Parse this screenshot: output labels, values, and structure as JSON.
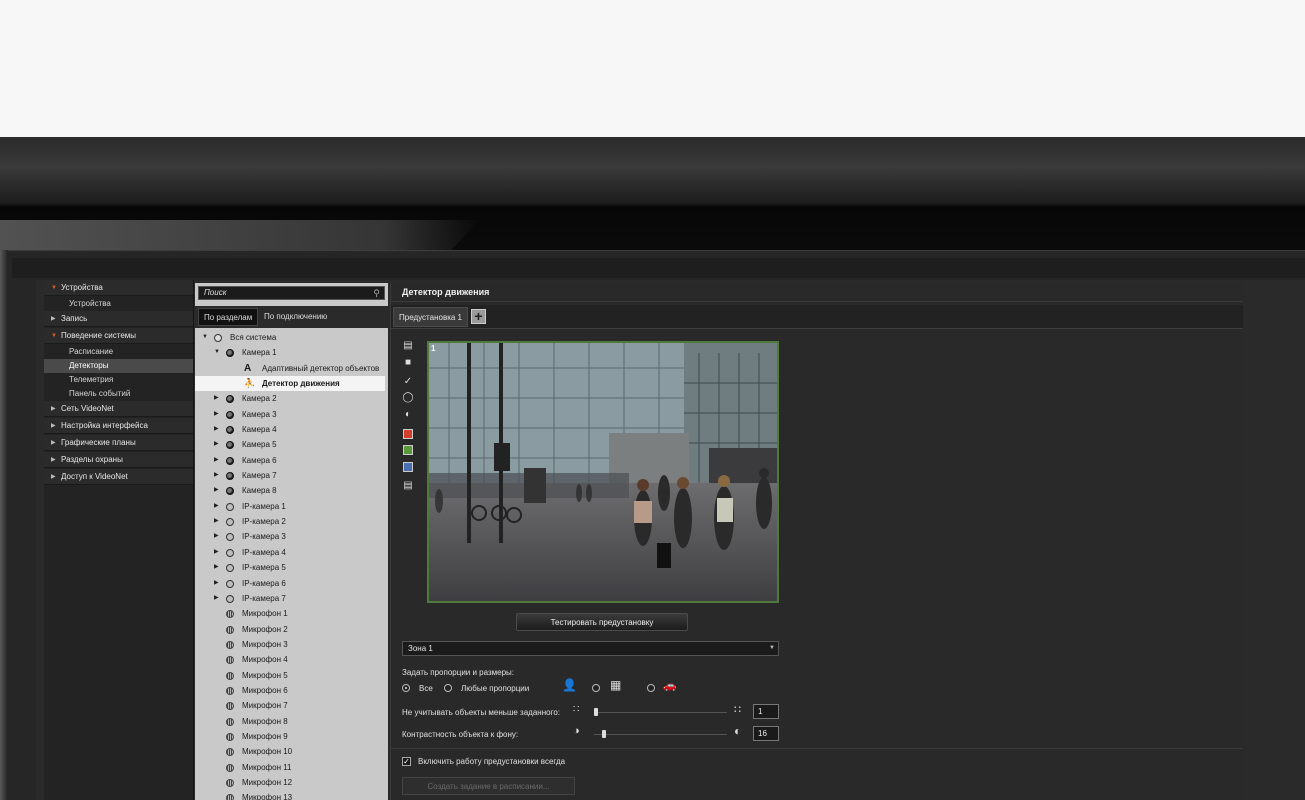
{
  "nav": {
    "sections": [
      {
        "label": "Устройства",
        "open": true,
        "items": [
          {
            "label": "Устройства"
          }
        ]
      },
      {
        "label": "Запись",
        "open": false,
        "items": []
      },
      {
        "label": "Поведение системы",
        "open": true,
        "items": [
          {
            "label": "Расписание"
          },
          {
            "label": "Детекторы",
            "active": true
          },
          {
            "label": "Телеметрия"
          },
          {
            "label": "Панель событий"
          }
        ]
      },
      {
        "label": "Сеть VideoNet",
        "open": false,
        "items": []
      },
      {
        "label": "Настройка интерфейса",
        "open": false,
        "items": []
      },
      {
        "label": "Графические планы",
        "open": false,
        "items": []
      },
      {
        "label": "Разделы охраны",
        "open": false,
        "items": []
      },
      {
        "label": "Доступ к VideoNet",
        "open": false,
        "items": []
      }
    ]
  },
  "tree_panel": {
    "search_placeholder": "Поиск",
    "tabs": [
      "По разделам",
      "По подключению"
    ],
    "rows": [
      {
        "label": "Вся система",
        "icon": "system-icon",
        "level": 0,
        "expand": "down"
      },
      {
        "label": "Камера 1",
        "icon": "camera-icon",
        "level": 1,
        "expand": "down"
      },
      {
        "label": "Адаптивный детектор объектов",
        "icon": "letter-a-icon",
        "level": 2,
        "expand": ""
      },
      {
        "label": "Детектор движения",
        "icon": "running-man-icon",
        "level": 2,
        "expand": "",
        "selected": true
      },
      {
        "label": "Камера 2",
        "icon": "camera-icon",
        "level": 1,
        "expand": "right"
      },
      {
        "label": "Камера 3",
        "icon": "camera-icon",
        "level": 1,
        "expand": "right"
      },
      {
        "label": "Камера 4",
        "icon": "camera-icon",
        "level": 1,
        "expand": "right"
      },
      {
        "label": "Камера 5",
        "icon": "camera-icon",
        "level": 1,
        "expand": "right"
      },
      {
        "label": "Камера 6",
        "icon": "camera-icon",
        "level": 1,
        "expand": "right"
      },
      {
        "label": "Камера 7",
        "icon": "camera-icon",
        "level": 1,
        "expand": "right"
      },
      {
        "label": "Камера 8",
        "icon": "camera-icon",
        "level": 1,
        "expand": "right"
      },
      {
        "label": "IP-камера 1",
        "icon": "ip-camera-icon",
        "level": 1,
        "expand": "right"
      },
      {
        "label": "IP-камера 2",
        "icon": "ip-camera-icon",
        "level": 1,
        "expand": "right"
      },
      {
        "label": "IP-камера 3",
        "icon": "ip-camera-icon",
        "level": 1,
        "expand": "right"
      },
      {
        "label": "IP-камера 4",
        "icon": "ip-camera-icon",
        "level": 1,
        "expand": "right"
      },
      {
        "label": "IP-камера 5",
        "icon": "ip-camera-icon",
        "level": 1,
        "expand": "right"
      },
      {
        "label": "IP-камера 6",
        "icon": "ip-camera-icon",
        "level": 1,
        "expand": "right"
      },
      {
        "label": "IP-камера 7",
        "icon": "ip-camera-icon",
        "level": 1,
        "expand": "right"
      },
      {
        "label": "Микрофон 1",
        "icon": "microphone-icon",
        "level": 1,
        "expand": ""
      },
      {
        "label": "Микрофон 2",
        "icon": "microphone-icon",
        "level": 1,
        "expand": ""
      },
      {
        "label": "Микрофон 3",
        "icon": "microphone-icon",
        "level": 1,
        "expand": ""
      },
      {
        "label": "Микрофон 4",
        "icon": "microphone-icon",
        "level": 1,
        "expand": ""
      },
      {
        "label": "Микрофон 5",
        "icon": "microphone-icon",
        "level": 1,
        "expand": ""
      },
      {
        "label": "Микрофон 6",
        "icon": "microphone-icon",
        "level": 1,
        "expand": ""
      },
      {
        "label": "Микрофон 7",
        "icon": "microphone-icon",
        "level": 1,
        "expand": ""
      },
      {
        "label": "Микрофон 8",
        "icon": "microphone-icon",
        "level": 1,
        "expand": ""
      },
      {
        "label": "Микрофон 9",
        "icon": "microphone-icon",
        "level": 1,
        "expand": ""
      },
      {
        "label": "Микрофон 10",
        "icon": "microphone-icon",
        "level": 1,
        "expand": ""
      },
      {
        "label": "Микрофон 11",
        "icon": "microphone-icon",
        "level": 1,
        "expand": ""
      },
      {
        "label": "Микрофон 12",
        "icon": "microphone-icon",
        "level": 1,
        "expand": ""
      },
      {
        "label": "Микрофон 13",
        "icon": "microphone-icon",
        "level": 1,
        "expand": ""
      }
    ]
  },
  "main": {
    "title": "Детектор движения",
    "preset_tab": "Предустановка 1",
    "add_preset": "+",
    "video_number": "1",
    "test_button": "Тестировать предустановку",
    "zone_select": "Зона 1",
    "proportions_label": "Задать пропорции и размеры:",
    "radio_all": "Все",
    "radio_any": "Любые пропорции",
    "min_size_label": "Не учитывать объекты меньше заданного:",
    "min_size_value": "1",
    "contrast_label": "Контрастность объекта к фону:",
    "contrast_value": "16",
    "always_on_label": "Включить работу предустановки всегда",
    "schedule_button": "Создать задание в расписании..."
  },
  "colors": {
    "accent_arrow": "#e05a2a",
    "video_border": "#4f7a3b",
    "tool_red": "#d0402a",
    "tool_green": "#5a9a3a",
    "tool_blue": "#4a6fb0"
  }
}
